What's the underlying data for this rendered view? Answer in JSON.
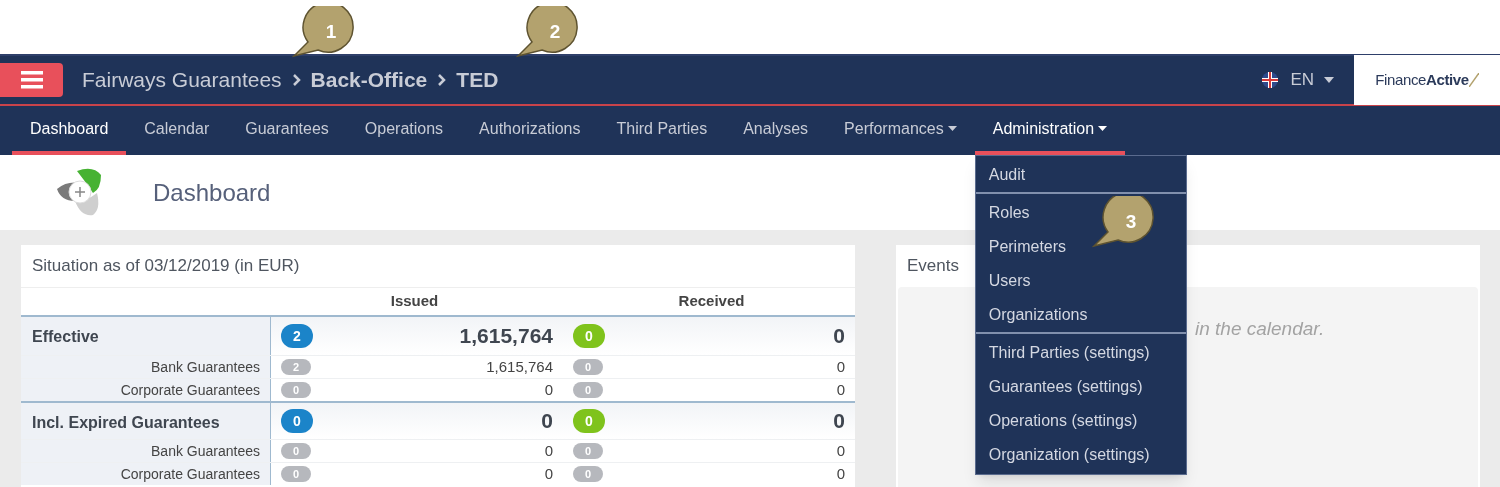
{
  "breadcrumb": [
    "Fairways Guarantees",
    "Back-Office",
    "TED"
  ],
  "language": "EN",
  "brand": {
    "light": "Finance",
    "bold": "Active"
  },
  "tabs": [
    {
      "label": "Dashboard",
      "selected": true,
      "has_menu": false
    },
    {
      "label": "Calendar",
      "selected": false,
      "has_menu": false
    },
    {
      "label": "Guarantees",
      "selected": false,
      "has_menu": false
    },
    {
      "label": "Operations",
      "selected": false,
      "has_menu": false
    },
    {
      "label": "Authorizations",
      "selected": false,
      "has_menu": false
    },
    {
      "label": "Third Parties",
      "selected": false,
      "has_menu": false
    },
    {
      "label": "Analyses",
      "selected": false,
      "has_menu": false
    },
    {
      "label": "Performances",
      "selected": false,
      "has_menu": true
    },
    {
      "label": "Administration",
      "selected": true,
      "has_menu": true,
      "menu": {
        "groups": [
          [
            "Audit"
          ],
          [
            "Roles",
            "Perimeters",
            "Users",
            "Organizations"
          ],
          [
            "Third Parties (settings)",
            "Guarantees (settings)",
            "Operations (settings)",
            "Organization (settings)"
          ]
        ]
      }
    }
  ],
  "page_title": "Dashboard",
  "situation": {
    "title": "Situation as of 03/12/2019 (in EUR)",
    "columns": [
      "Issued",
      "Received"
    ],
    "rows": [
      {
        "kind": "group",
        "label": "Effective",
        "issued_count": "2",
        "issued": "1,615,764",
        "received_count": "0",
        "received": "0"
      },
      {
        "kind": "sub",
        "label": "Bank Guarantees",
        "issued_count": "2",
        "issued": "1,615,764",
        "received_count": "0",
        "received": "0"
      },
      {
        "kind": "sub",
        "label": "Corporate Guarantees",
        "issued_count": "0",
        "issued": "0",
        "received_count": "0",
        "received": "0"
      },
      {
        "kind": "group",
        "label": "Incl. Expired Guarantees",
        "issued_count": "0",
        "issued": "0",
        "received_count": "0",
        "received": "0"
      },
      {
        "kind": "sub",
        "label": "Bank Guarantees",
        "issued_count": "0",
        "issued": "0",
        "received_count": "0",
        "received": "0"
      },
      {
        "kind": "sub",
        "label": "Corporate Guarantees",
        "issued_count": "0",
        "issued": "0",
        "received_count": "0",
        "received": "0"
      }
    ]
  },
  "events": {
    "title": "Events",
    "message": "in the calendar."
  },
  "callouts": [
    "1",
    "2",
    "3"
  ]
}
